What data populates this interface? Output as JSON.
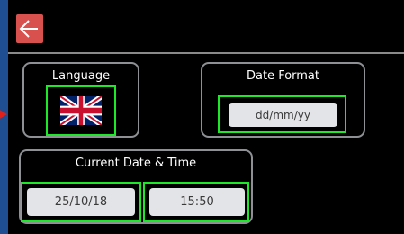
{
  "header": {
    "back_icon": "arrow-left-icon",
    "back_color": "#d9514e"
  },
  "language": {
    "title": "Language",
    "selected_icon": "uk-flag-icon"
  },
  "date_format": {
    "title": "Date Format",
    "value": "dd/mm/yy"
  },
  "current_datetime": {
    "title": "Current Date & Time",
    "date": "25/10/18",
    "time": "15:50"
  },
  "colors": {
    "background": "#000000",
    "panel_border": "#8e9094",
    "selection_highlight": "#1ee82a",
    "pill_background": "#e3e4e7",
    "edge_strip": "#1f4e92",
    "pointer_marker": "#e0201b"
  }
}
